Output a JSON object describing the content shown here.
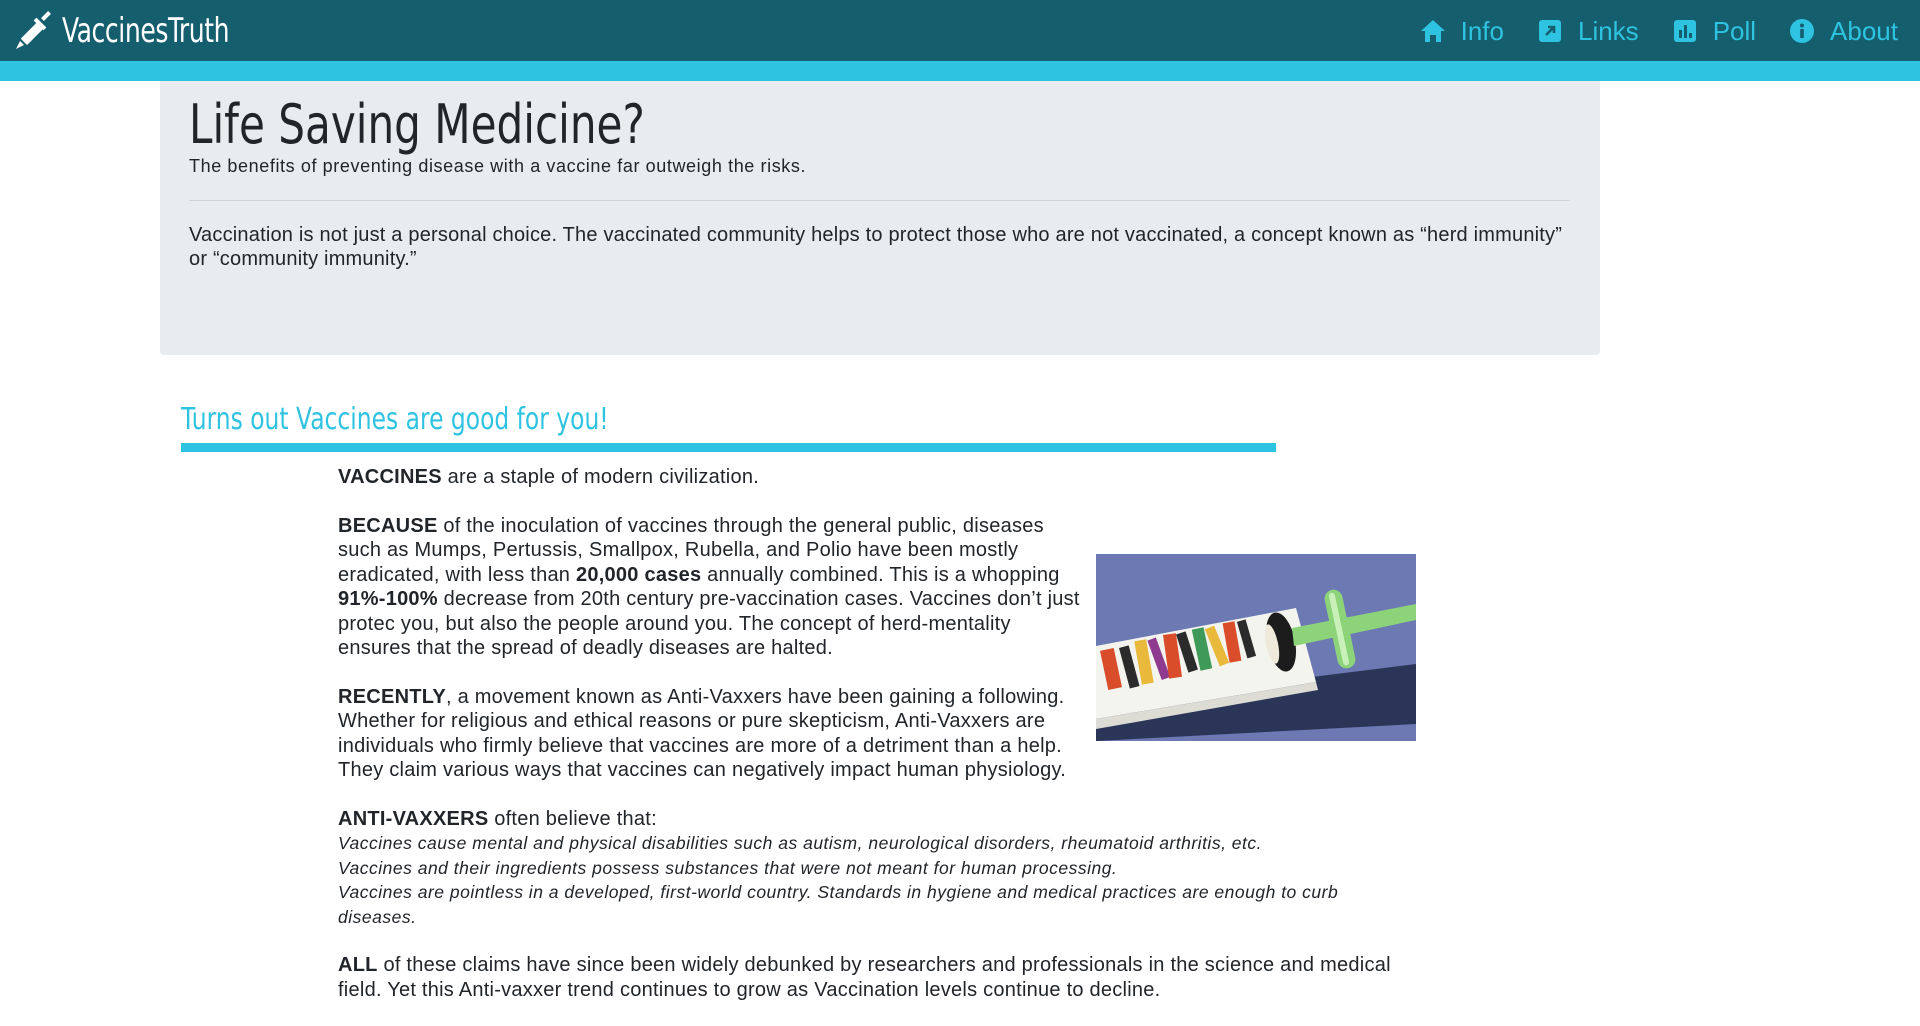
{
  "brand": {
    "name": "VaccinesTruth",
    "icon": "syringe-icon"
  },
  "nav": [
    {
      "label": "Info",
      "icon": "home-icon"
    },
    {
      "label": "Links",
      "icon": "external-link-icon"
    },
    {
      "label": "Poll",
      "icon": "bar-chart-icon"
    },
    {
      "label": "About",
      "icon": "info-icon"
    }
  ],
  "jumbotron": {
    "title": "Life Saving Medicine?",
    "lead": "The benefits of preventing disease with a vaccine far outweigh the risks.",
    "body": "Vaccination is not just a personal choice. The vaccinated community helps to protect those who are not vaccinated, a concept known as “herd immunity” or “community immunity.”"
  },
  "section": {
    "title": "Turns out Vaccines are good for you!",
    "p1": {
      "lead": "VACCINES",
      "text": " are a staple of modern civilization."
    },
    "p2": {
      "lead": "BECAUSE",
      "t1": " of the inoculation of vaccines through the general public, diseases such as Mumps, Pertussis, Smallpox, Rubella, and Polio have been mostly eradicated, with less than ",
      "b1": "20,000 cases",
      "t2": " annually combined. This is a whopping ",
      "b2": "91%-100%",
      "t3": " decrease from 20th century pre-vaccination cases. Vaccines don’t just protec you, but also the people around you. The concept of herd-mentality ensures that the spread of deadly diseases are halted."
    },
    "p3": {
      "lead": "RECENTLY",
      "text": ", a movement known as Anti-Vaxxers have been gaining a following. Whether for religious and ethical reasons or pure skepticism, Anti-Vaxxers are individuals who firmly believe that vaccines are more of a detriment than a help. They claim various ways that vaccines can negatively impact human physiology."
    },
    "p4": {
      "lead": "ANTI-VAXXERS",
      "text": " often believe that:",
      "claims": [
        "Vaccines cause mental and physical disabilities such as autism, neurological disorders, rheumatoid arthritis, etc.",
        "Vaccines and their ingredients possess substances that were not meant for human processing.",
        "Vaccines are pointless in a developed, first-world country. Standards in hygiene and medical practices are enough to curb diseases."
      ]
    },
    "p5": {
      "lead": "ALL",
      "text": " of these claims have since been widely debunked by researchers and professionals in the science and medical field. Yet this Anti-vaxxer trend continues to grow as Vaccination levels continue to decline."
    }
  },
  "colors": {
    "navbar": "#155e6e",
    "accent": "#2ec3e0",
    "jumbotron": "#e9ecef",
    "figure_bg": "#6c79b3"
  }
}
